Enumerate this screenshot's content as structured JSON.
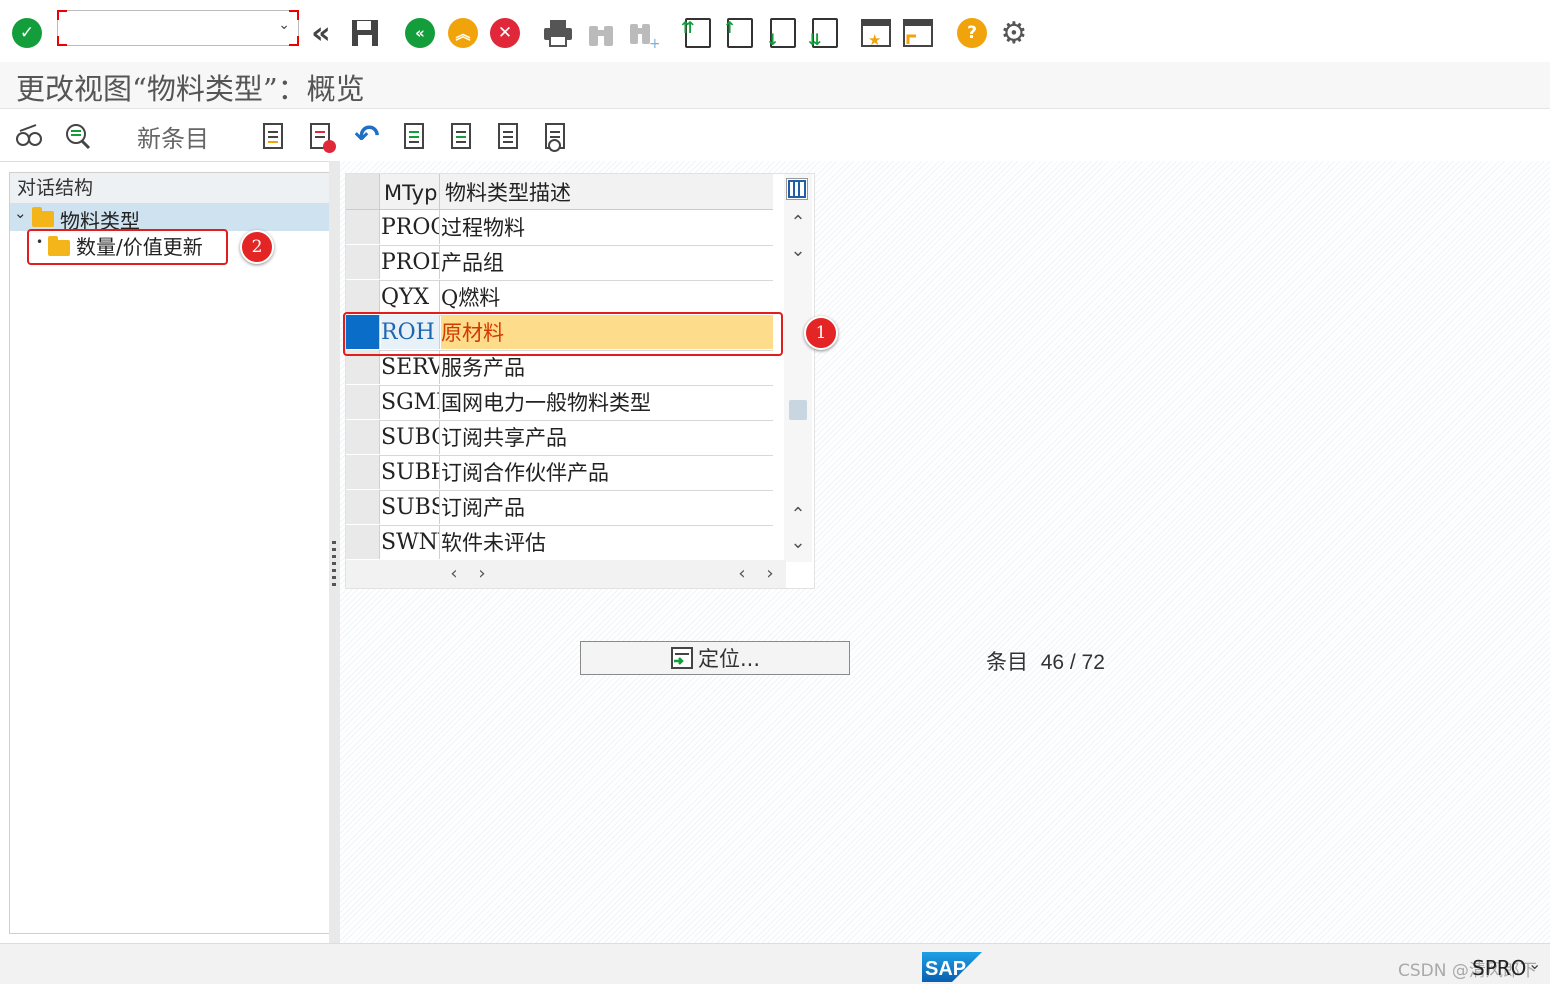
{
  "system_toolbar": {
    "command_field": {
      "value": ""
    },
    "icons": [
      "enter-icon",
      "back-double-icon",
      "save-icon",
      "back-icon",
      "exit-icon",
      "cancel-icon",
      "print-icon",
      "find-icon",
      "find-next-icon",
      "first-page-icon",
      "previous-page-icon",
      "next-page-icon",
      "last-page-icon",
      "create-session-icon",
      "shortcut-icon",
      "help-icon",
      "customize-layout-icon"
    ]
  },
  "title": "更改视图“物料类型”：概览",
  "app_toolbar": {
    "new_entries_label": "新条目",
    "icons": [
      "display-change-icon",
      "other-view-icon",
      "copy-as-icon",
      "delete-icon",
      "undo-icon",
      "select-all-icon",
      "select-block-icon",
      "deselect-all-icon",
      "print-view-icon"
    ]
  },
  "dialog_structure": {
    "header": "对话结构",
    "root": "物料类型",
    "child": "数量/价值更新"
  },
  "table": {
    "columns": [
      "MTyp",
      "物料类型描述"
    ],
    "rows": [
      {
        "code": "PROC",
        "desc": "过程物料"
      },
      {
        "code": "PROD",
        "desc": "产品组"
      },
      {
        "code": "QYX",
        "desc": "Q燃料"
      },
      {
        "code": "ROH",
        "desc": "原材料",
        "selected": true
      },
      {
        "code": "SERV",
        "desc": "服务产品"
      },
      {
        "code": "SGMM",
        "desc": "国网电力一般物料类型"
      },
      {
        "code": "SUBC",
        "desc": "订阅共享产品"
      },
      {
        "code": "SUBP",
        "desc": "订阅合作伙伴产品"
      },
      {
        "code": "SUBS",
        "desc": "订阅产品"
      },
      {
        "code": "SWNV",
        "desc": "软件未评估"
      }
    ]
  },
  "annotations": {
    "badge1": "1",
    "badge2": "2"
  },
  "position_button": "定位...",
  "entries": {
    "label": "条目",
    "text": "46 / 72"
  },
  "status_bar": {
    "sap_logo": "SAP",
    "tcode": "SPRO",
    "watermark": "CSDN @清风郎下"
  },
  "colors": {
    "accent_green": "#139e3b",
    "selected_row": "#fddc8b",
    "highlight_red": "#e11d1d"
  }
}
